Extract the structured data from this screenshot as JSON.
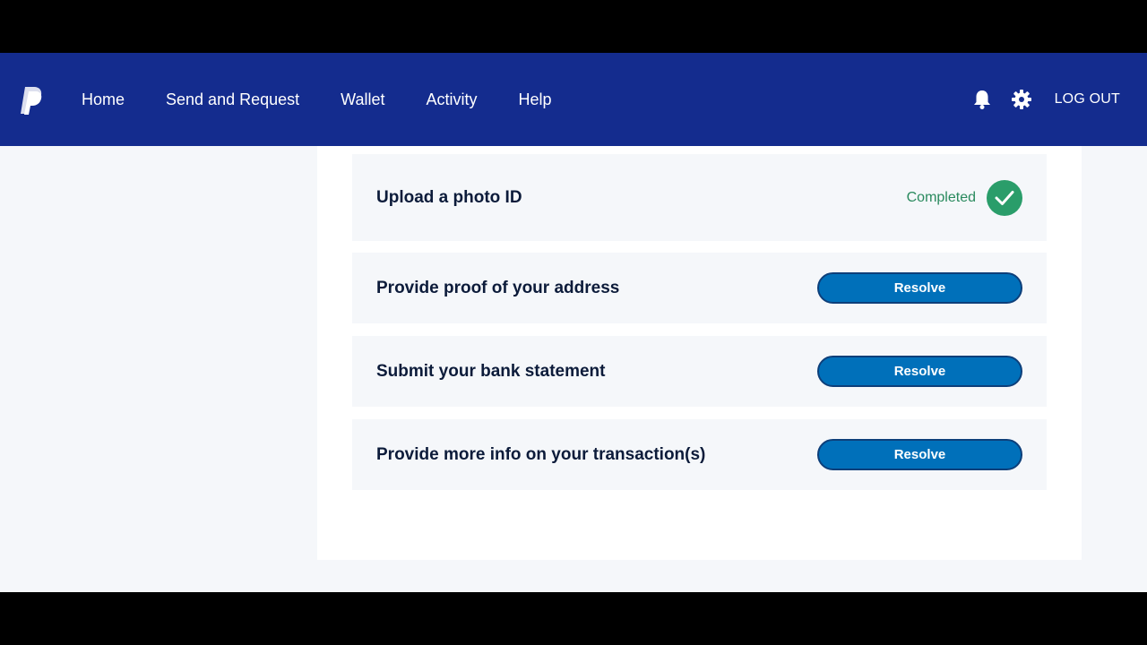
{
  "nav": {
    "items": [
      "Home",
      "Send and Request",
      "Wallet",
      "Activity",
      "Help"
    ],
    "notifications_icon": "bell-icon",
    "settings_icon": "gear-icon",
    "logout_label": "LOG OUT"
  },
  "tasks": [
    {
      "title": "Upload a photo ID",
      "status": "Completed"
    },
    {
      "title": "Provide proof of your address",
      "action": "Resolve"
    },
    {
      "title": "Submit your bank statement",
      "action": "Resolve"
    },
    {
      "title": "Provide more info on your transaction(s)",
      "action": "Resolve"
    }
  ],
  "colors": {
    "nav_bg": "#142c8e",
    "button": "#0070ba",
    "success": "#2a9d6a"
  }
}
